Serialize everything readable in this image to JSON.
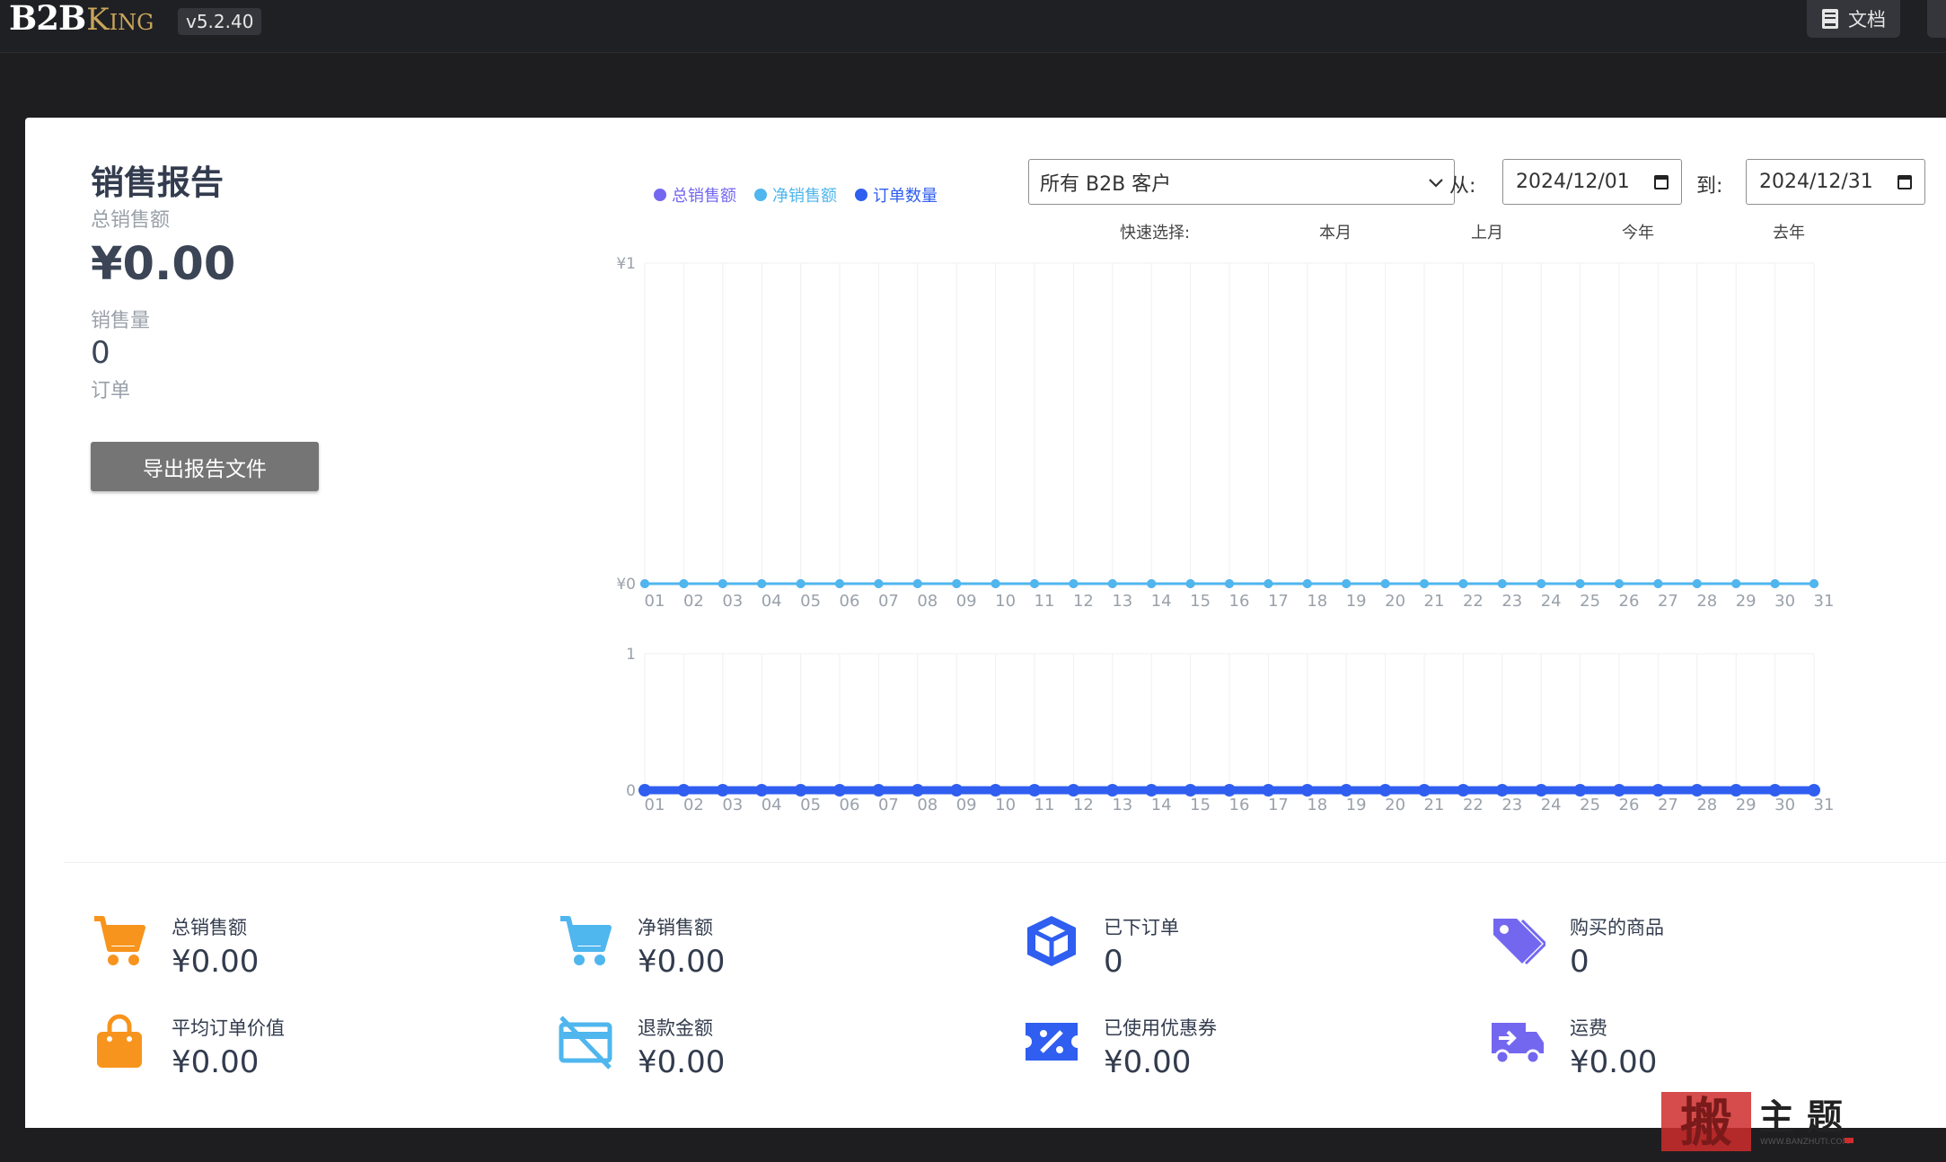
{
  "topbar": {
    "logo_b2b": "B2B",
    "logo_king": "King",
    "version": "v5.2.40",
    "docs_label": "文档",
    "docs_icon": "book-icon"
  },
  "report": {
    "title": "销售报告",
    "total_sales_label": "总销售额",
    "total_sales_value": "¥0.00",
    "sales_qty_label": "销售量",
    "sales_qty_value": "0",
    "orders_label": "订单",
    "export_label": "导出报告文件"
  },
  "legend": [
    {
      "name": "总销售额",
      "color": "#7367f0"
    },
    {
      "name": "净销售额",
      "color": "#4fb6ee"
    },
    {
      "name": "订单数量",
      "color": "#2f5ef0"
    }
  ],
  "filters": {
    "customer_select": "所有 B2B 客户",
    "from_label": "从:",
    "from_date": "2024/12/01",
    "to_label": "到:",
    "to_date": "2024/12/31",
    "quick_label": "快速选择:",
    "quick_options": [
      "本月",
      "上月",
      "今年",
      "去年"
    ]
  },
  "chart_data": [
    {
      "type": "line",
      "x": [
        "01",
        "02",
        "03",
        "04",
        "05",
        "06",
        "07",
        "08",
        "09",
        "10",
        "11",
        "12",
        "13",
        "14",
        "15",
        "16",
        "17",
        "18",
        "19",
        "20",
        "21",
        "22",
        "23",
        "24",
        "25",
        "26",
        "27",
        "28",
        "29",
        "30",
        "31"
      ],
      "yticks": [
        "¥1",
        "¥0"
      ],
      "ylim": [
        0,
        1
      ],
      "series": [
        {
          "name": "总销售额",
          "values": [
            0,
            0,
            0,
            0,
            0,
            0,
            0,
            0,
            0,
            0,
            0,
            0,
            0,
            0,
            0,
            0,
            0,
            0,
            0,
            0,
            0,
            0,
            0,
            0,
            0,
            0,
            0,
            0,
            0,
            0,
            0
          ],
          "color": "#7367f0"
        },
        {
          "name": "净销售额",
          "values": [
            0,
            0,
            0,
            0,
            0,
            0,
            0,
            0,
            0,
            0,
            0,
            0,
            0,
            0,
            0,
            0,
            0,
            0,
            0,
            0,
            0,
            0,
            0,
            0,
            0,
            0,
            0,
            0,
            0,
            0,
            0
          ],
          "color": "#4fb6ee"
        }
      ],
      "grid": true
    },
    {
      "type": "line",
      "x": [
        "01",
        "02",
        "03",
        "04",
        "05",
        "06",
        "07",
        "08",
        "09",
        "10",
        "11",
        "12",
        "13",
        "14",
        "15",
        "16",
        "17",
        "18",
        "19",
        "20",
        "21",
        "22",
        "23",
        "24",
        "25",
        "26",
        "27",
        "28",
        "29",
        "30",
        "31"
      ],
      "yticks": [
        "1",
        "0"
      ],
      "ylim": [
        0,
        1
      ],
      "series": [
        {
          "name": "订单数量",
          "values": [
            0,
            0,
            0,
            0,
            0,
            0,
            0,
            0,
            0,
            0,
            0,
            0,
            0,
            0,
            0,
            0,
            0,
            0,
            0,
            0,
            0,
            0,
            0,
            0,
            0,
            0,
            0,
            0,
            0,
            0,
            0
          ],
          "color": "#2f5ef0"
        }
      ],
      "grid": true
    }
  ],
  "stats": [
    {
      "label": "总销售额",
      "value": "¥0.00",
      "icon": "cart-icon",
      "color": "#f7941d"
    },
    {
      "label": "净销售额",
      "value": "¥0.00",
      "icon": "cart-icon",
      "color": "#4fb6ee"
    },
    {
      "label": "已下订单",
      "value": "0",
      "icon": "box-icon",
      "color": "#2f5ef0"
    },
    {
      "label": "购买的商品",
      "value": "0",
      "icon": "tag-icon",
      "color": "#7367f0"
    },
    {
      "label": "平均订单价值",
      "value": "¥0.00",
      "icon": "bag-icon",
      "color": "#f7941d"
    },
    {
      "label": "退款金额",
      "value": "¥0.00",
      "icon": "refund-icon",
      "color": "#4fb6ee"
    },
    {
      "label": "已使用优惠券",
      "value": "¥0.00",
      "icon": "coupon-icon",
      "color": "#2f5ef0"
    },
    {
      "label": "运费",
      "value": "¥0.00",
      "icon": "truck-icon",
      "color": "#7367f0"
    }
  ],
  "watermark": {
    "main": "搬主题",
    "url": "WWW.BANZHUTI.COM"
  }
}
